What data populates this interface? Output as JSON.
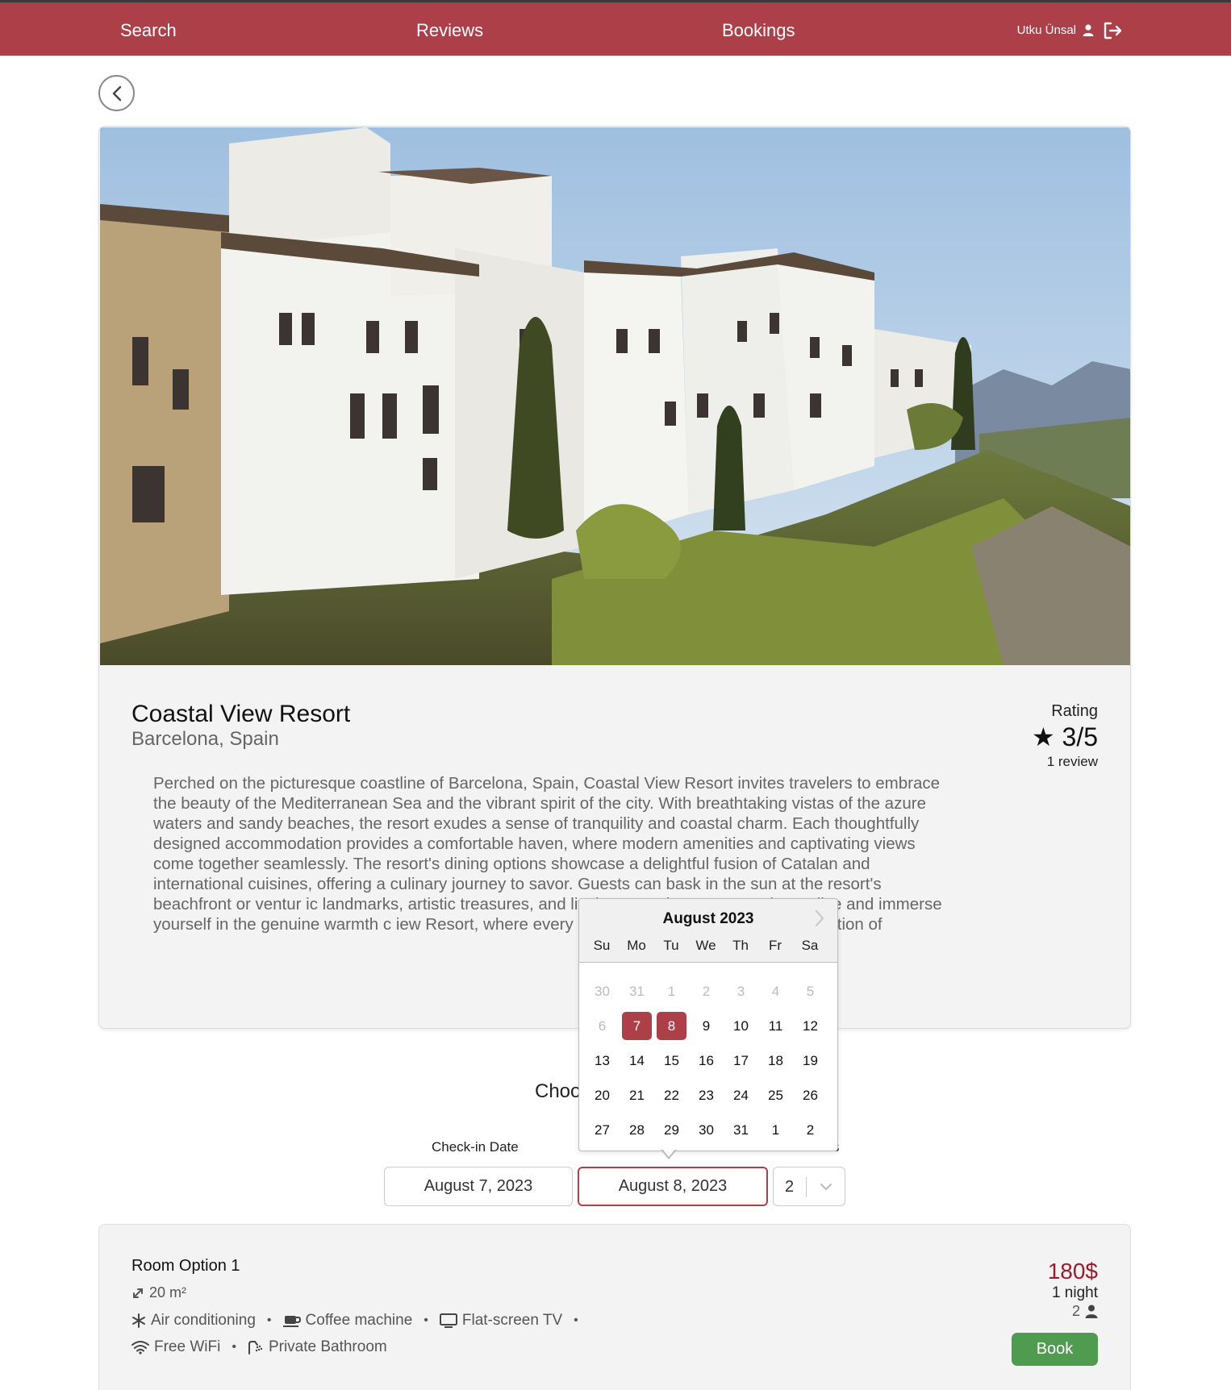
{
  "nav": {
    "search": "Search",
    "reviews": "Reviews",
    "bookings": "Bookings",
    "user_name": "Utku Ünsal"
  },
  "hotel": {
    "name": "Coastal View Resort",
    "location": "Barcelona, Spain",
    "rating_label": "Rating",
    "rating_value": "★ 3/5",
    "review_count": "1 review",
    "description": "Perched on the picturesque coastline of Barcelona, Spain, Coastal View Resort invites travelers to embrace the beauty of the Mediterranean Sea and the vibrant spirit of the city. With breathtaking vistas of the azure waters and sandy beaches, the resort exudes a sense of tranquility and coastal charm. Each thoughtfully designed accommodation provides a comfortable haven, where modern amenities and captivating views come together seamlessly. The resort's dining options showcase a delightful fusion of Catalan and international cuisines, offering a culinary journey to savor. Guests can bask in the sun at the resort's beachfront or ventur                                              ic landmarks, artistic treasures, and lively atmosphere. Er                                              oastal paradise and immerse yourself in the genuine warmth c                                              iew Resort, where every moment is an unforgettable celebration of"
  },
  "booking": {
    "choose_title": "Choo",
    "checkin_label": "Check-in Date",
    "guests_label_fragment": "s",
    "checkin_value": "August 7, 2023",
    "checkout_value": "August 8, 2023",
    "guests_value": "2"
  },
  "datepicker": {
    "month": "August 2023",
    "weekdays": [
      "Su",
      "Mo",
      "Tu",
      "We",
      "Th",
      "Fr",
      "Sa"
    ],
    "weeks": [
      [
        "30",
        "31",
        "1",
        "2",
        "3",
        "4",
        "5"
      ],
      [
        "6",
        "7",
        "8",
        "9",
        "10",
        "11",
        "12"
      ],
      [
        "13",
        "14",
        "15",
        "16",
        "17",
        "18",
        "19"
      ],
      [
        "20",
        "21",
        "22",
        "23",
        "24",
        "25",
        "26"
      ],
      [
        "27",
        "28",
        "29",
        "30",
        "31",
        "1",
        "2"
      ]
    ],
    "muted_days": [
      [
        0,
        0
      ],
      [
        0,
        1
      ],
      [
        0,
        2
      ],
      [
        0,
        3
      ],
      [
        0,
        4
      ],
      [
        0,
        5
      ],
      [
        0,
        6
      ],
      [
        1,
        0
      ]
    ],
    "selected_days": [
      [
        1,
        1
      ],
      [
        1,
        2
      ]
    ],
    "accent_color": "#ad3f49"
  },
  "room": {
    "title": "Room Option 1",
    "size": "20 m²",
    "amenities_row1": [
      "Air conditioning",
      "Coffee machine",
      "Flat-screen TV"
    ],
    "amenities_row2": [
      "Free WiFi",
      "Private Bathroom"
    ],
    "price": "180$",
    "nights": "1 night",
    "guests": "2",
    "book_label": "Book"
  },
  "colors": {
    "brand": "#ad3f49",
    "price": "#9c1c28",
    "book_button": "#4f9b4f"
  },
  "icons": {
    "user": "user-icon",
    "logout": "logout-icon",
    "back": "chevron-left-icon",
    "size": "resize-icon",
    "ac": "snowflake-icon",
    "coffee": "coffee-icon",
    "tv": "tv-icon",
    "wifi": "wifi-icon",
    "bath": "shower-icon"
  }
}
